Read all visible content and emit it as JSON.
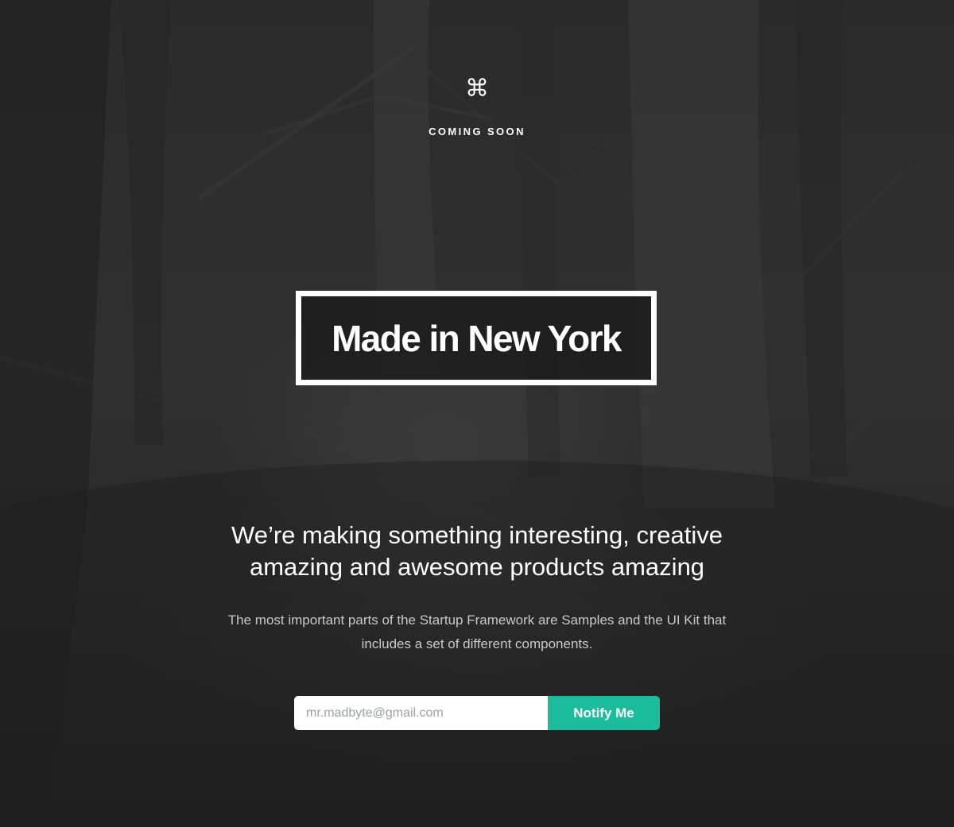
{
  "logo": {
    "icon": "command-icon",
    "glyph": "⌘"
  },
  "header": {
    "tagline": "COMING SOON"
  },
  "hero": {
    "headline": "Made in New York",
    "lead": "We’re making something interesting, creative amazing and awesome products amazing",
    "description": "The most important parts of the Startup Framework are Samples and the UI Kit that includes a set of different components."
  },
  "subscribe": {
    "email_placeholder": "mr.madbyte@gmail.com",
    "email_value": "",
    "button_label": "Notify Me"
  },
  "colors": {
    "accent": "#1abc9c",
    "background": "#2b2b2b",
    "text": "#ffffff",
    "muted_text": "#c9c9c9"
  }
}
